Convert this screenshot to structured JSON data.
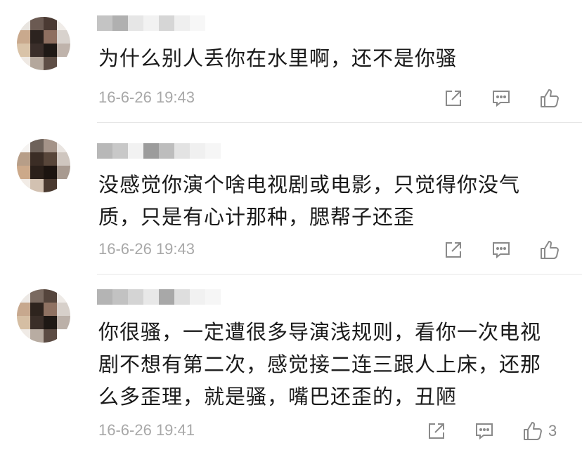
{
  "comments": [
    {
      "text": "为什么别人丢你在水里啊，还不是你骚",
      "lines": [
        "为什么别人丢你在水里啊，还不是你骚"
      ],
      "timestamp": "16-6-26 19:43",
      "likes": ""
    },
    {
      "text": "没感觉你演个啥电视剧或电影，只觉得你没气质，只是有心计那种，腮帮子还歪",
      "lines": [
        "没感觉你演个啥电视剧或电影，只觉得你没气",
        "质，只是有心计那种，腮帮子还歪"
      ],
      "timestamp": "16-6-26 19:43",
      "likes": ""
    },
    {
      "text": "你很骚，一定遭很多导演浅规则，看你一次电视剧不想有第二次，感觉接二连三跟人上床，还那么多歪理，就是骚，嘴巴还歪的，丑陋",
      "lines": [
        "你很骚，一定遭很多导演浅规则，看你一次电视",
        "剧不想有第二次，感觉接二连三跟人上床，还那",
        "么多歪理，就是骚，嘴巴还歪的，丑陋"
      ],
      "timestamp": "16-6-26 19:41",
      "likes": "3"
    }
  ],
  "icons": {
    "share": "share-icon",
    "comment": "comment-icon",
    "like": "thumbs-up-icon"
  },
  "colors": {
    "text": "#1a1a1a",
    "timestamp": "#a8a8a8",
    "icon": "#8a8a8a",
    "divider": "#e6e6e6"
  }
}
